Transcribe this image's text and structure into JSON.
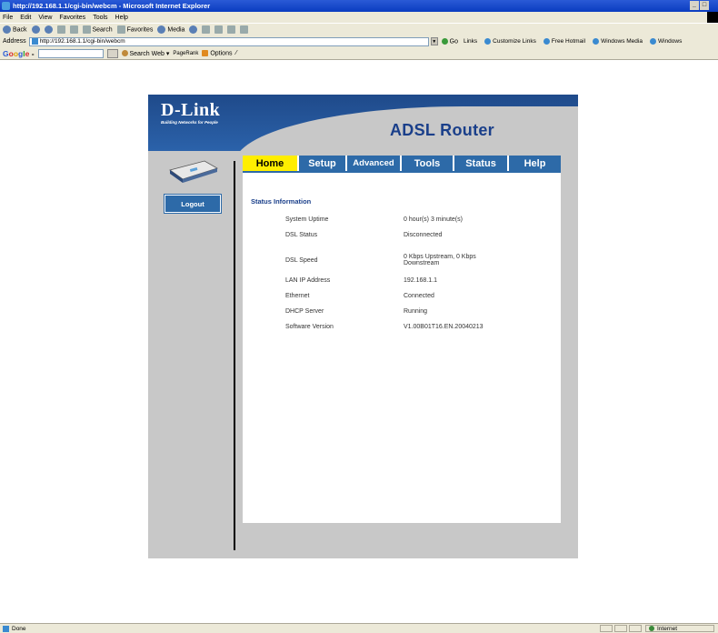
{
  "browser": {
    "title": "http://192.168.1.1/cgi-bin/webcm - Microsoft Internet Explorer",
    "menu": [
      "File",
      "Edit",
      "View",
      "Favorites",
      "Tools",
      "Help"
    ],
    "toolbar": {
      "back": "Back",
      "search": "Search",
      "favorites": "Favorites",
      "media": "Media"
    },
    "address_label": "Address",
    "address_value": "http://192.168.1.1/cgi-bin/webcm",
    "go_label": "Go",
    "links_label": "Links",
    "links": [
      "Customize Links",
      "Free Hotmail",
      "Windows Media",
      "Windows"
    ],
    "google": {
      "logo": [
        "G",
        "o",
        "o",
        "g",
        "l",
        "e"
      ],
      "search_web": "Search Web",
      "pagerank": "PageRank",
      "options": "Options"
    },
    "status_text": "Done",
    "zone_text": "Internet"
  },
  "router": {
    "brand": "D-Link",
    "tagline": "Building Networks for People",
    "product": "ADSL Router",
    "logout_label": "Logout",
    "tabs": [
      "Home",
      "Setup",
      "Advanced",
      "Tools",
      "Status",
      "Help"
    ],
    "panel_title": "Status Information",
    "status": [
      {
        "label": "System Uptime",
        "value": "0 hour(s) 3 minute(s)"
      },
      {
        "label": "DSL Status",
        "value": "Disconnected"
      },
      {
        "label": "DSL Speed",
        "value": "0 Kbps Upstream, 0 Kbps Downstream"
      },
      {
        "label": "LAN IP Address",
        "value": "192.168.1.1"
      },
      {
        "label": "Ethernet",
        "value": "Connected"
      },
      {
        "label": "DHCP Server",
        "value": "Running"
      },
      {
        "label": "Software Version",
        "value": "V1.00B01T16.EN.20040213"
      }
    ]
  },
  "colors": {
    "tab_active": "#ffee00",
    "tab_bg": "#2d6aa8",
    "product_text": "#1a3f8a"
  }
}
